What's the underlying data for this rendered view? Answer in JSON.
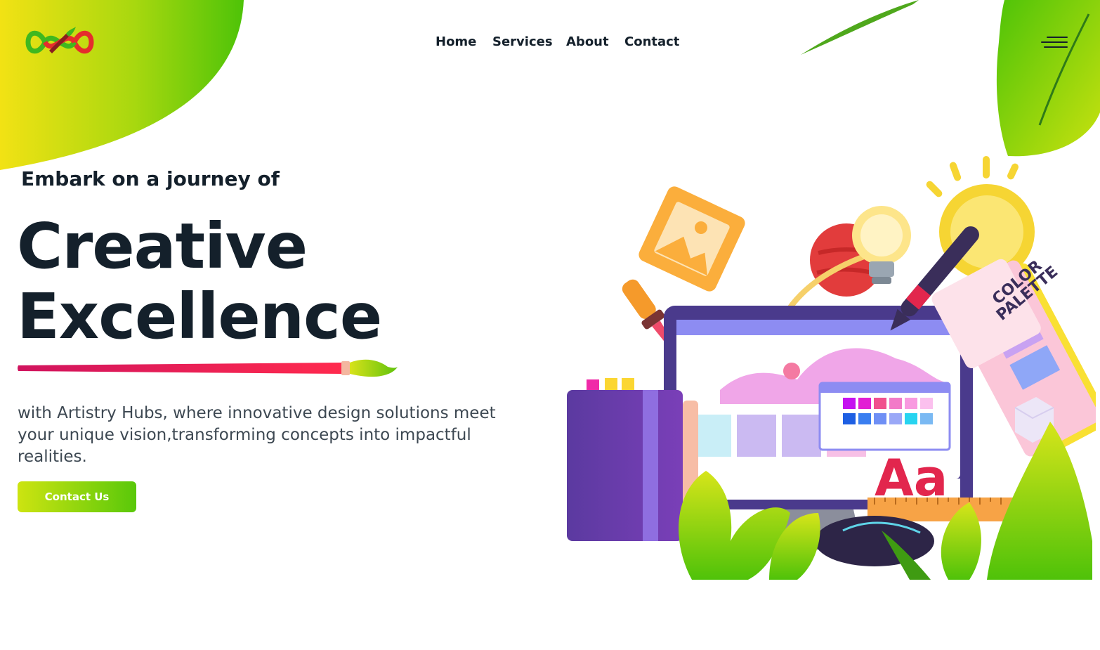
{
  "brand": {
    "logo_icon": "infinity-paintbrush-logo-icon"
  },
  "nav": {
    "items": [
      {
        "label": "Home"
      },
      {
        "label": "Services"
      },
      {
        "label": "About"
      },
      {
        "label": "Contact"
      }
    ],
    "menu_icon": "hamburger-menu-icon"
  },
  "hero": {
    "eyebrow": "Embark on a journey of",
    "headline_line1": "Creative",
    "headline_line2": "Excellence",
    "description": "with Artistry Hubs, where innovative design solutions meet your unique vision,transforming concepts into impactful realities.",
    "cta_label": "Contact Us",
    "illustration": {
      "palette_label_line1": "COLOR",
      "palette_label_line2": "PALETTE",
      "letters": "Aa"
    }
  },
  "colors": {
    "accent_green": "#59c80a",
    "accent_yellow": "#e9e21a",
    "dark_text": "#14202b",
    "brush_pink": "#e8145f"
  }
}
